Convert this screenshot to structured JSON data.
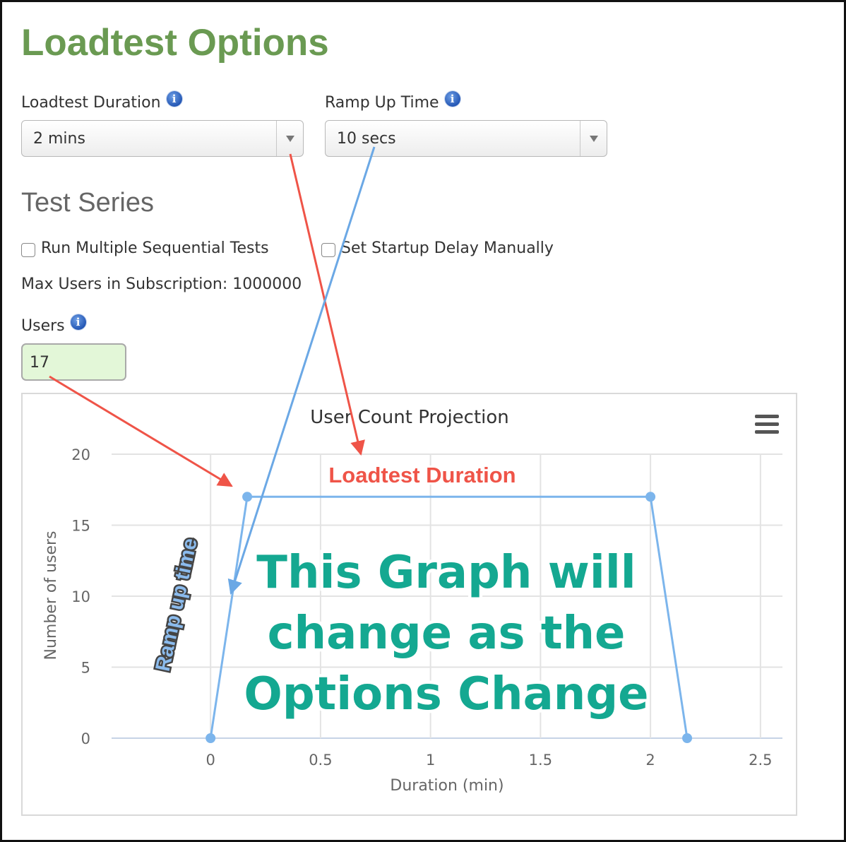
{
  "title": "Loadtest Options",
  "duration": {
    "label": "Loadtest Duration",
    "value": "2 mins"
  },
  "ramp_up": {
    "label": "Ramp Up Time",
    "value": "10 secs"
  },
  "info_icon_glyph": "i",
  "test_series": {
    "heading": "Test Series",
    "run_multiple": {
      "label": "Run Multiple Sequential Tests",
      "checked": false
    },
    "startup_delay": {
      "label": "Set Startup Delay Manually",
      "checked": false
    }
  },
  "max_users_text": "Max Users in Subscription: 1000000",
  "users": {
    "label": "Users",
    "value": "17"
  },
  "chart_data": {
    "type": "line",
    "title": "User Count Projection",
    "xlabel": "Duration (min)",
    "ylabel": "Number of users",
    "xlim": [
      -0.45,
      2.6
    ],
    "ylim": [
      0,
      20
    ],
    "x_ticks": [
      0,
      0.5,
      1,
      1.5,
      2,
      2.5
    ],
    "x_tick_labels": [
      "0",
      "0.5",
      "1",
      "1.5",
      "2",
      "2.5"
    ],
    "y_ticks": [
      0,
      5,
      10,
      15,
      20
    ],
    "y_tick_labels": [
      "0",
      "5",
      "10",
      "15",
      "20"
    ],
    "grid": true,
    "series": [
      {
        "points": [
          [
            0,
            0
          ],
          [
            0.1667,
            17
          ],
          [
            2,
            17
          ],
          [
            2.1667,
            0
          ]
        ],
        "color": "#7cb5ec"
      }
    ]
  },
  "annotations": {
    "duration_label": "Loadtest Duration",
    "ramp_label": "Ramp up time",
    "overlay_lines": [
      "This Graph will",
      "change as the",
      "Options Change"
    ],
    "red_color": "#ef5448",
    "blue_color": "#6ba8e5",
    "teal_color": "#14a891"
  },
  "menu_icon": "hamburger-menu-icon"
}
